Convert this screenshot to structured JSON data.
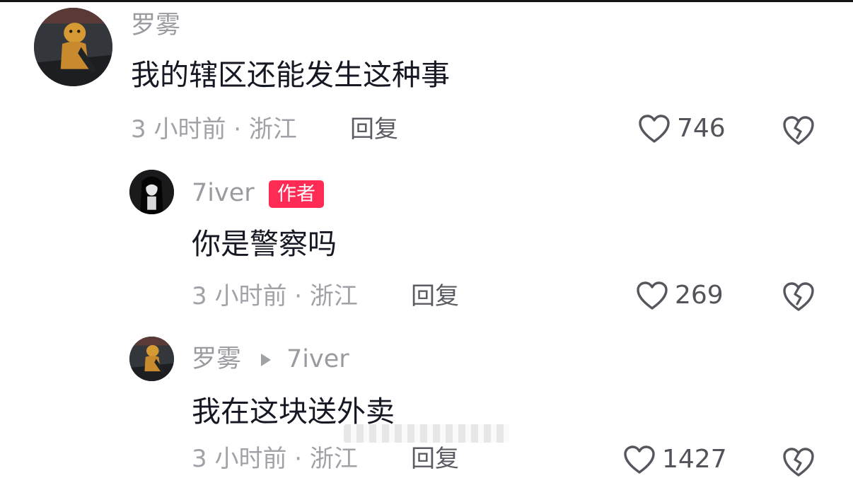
{
  "colors": {
    "primary_text": "#161823",
    "secondary_text": "#a1a2a8",
    "author_badge_bg": "#fe2c55"
  },
  "comments": [
    {
      "username": "罗雾",
      "text": "我的辖区还能发生这种事",
      "time_location": "3 小时前 · 浙江",
      "reply_label": "回复",
      "likes": "746",
      "icons": [
        "heart-icon",
        "broken-heart-icon"
      ]
    },
    {
      "username": "7iver",
      "badge": "作者",
      "text": "你是警察吗",
      "time_location": "3 小时前 · 浙江",
      "reply_label": "回复",
      "likes": "269",
      "icons": [
        "heart-icon",
        "broken-heart-icon"
      ]
    },
    {
      "username": "罗雾",
      "reply_to": "7iver",
      "text": "我在这块送外卖",
      "time_location": "3 小时前 · 浙江",
      "reply_label": "回复",
      "likes": "1427",
      "icons": [
        "heart-icon",
        "broken-heart-icon"
      ]
    }
  ]
}
